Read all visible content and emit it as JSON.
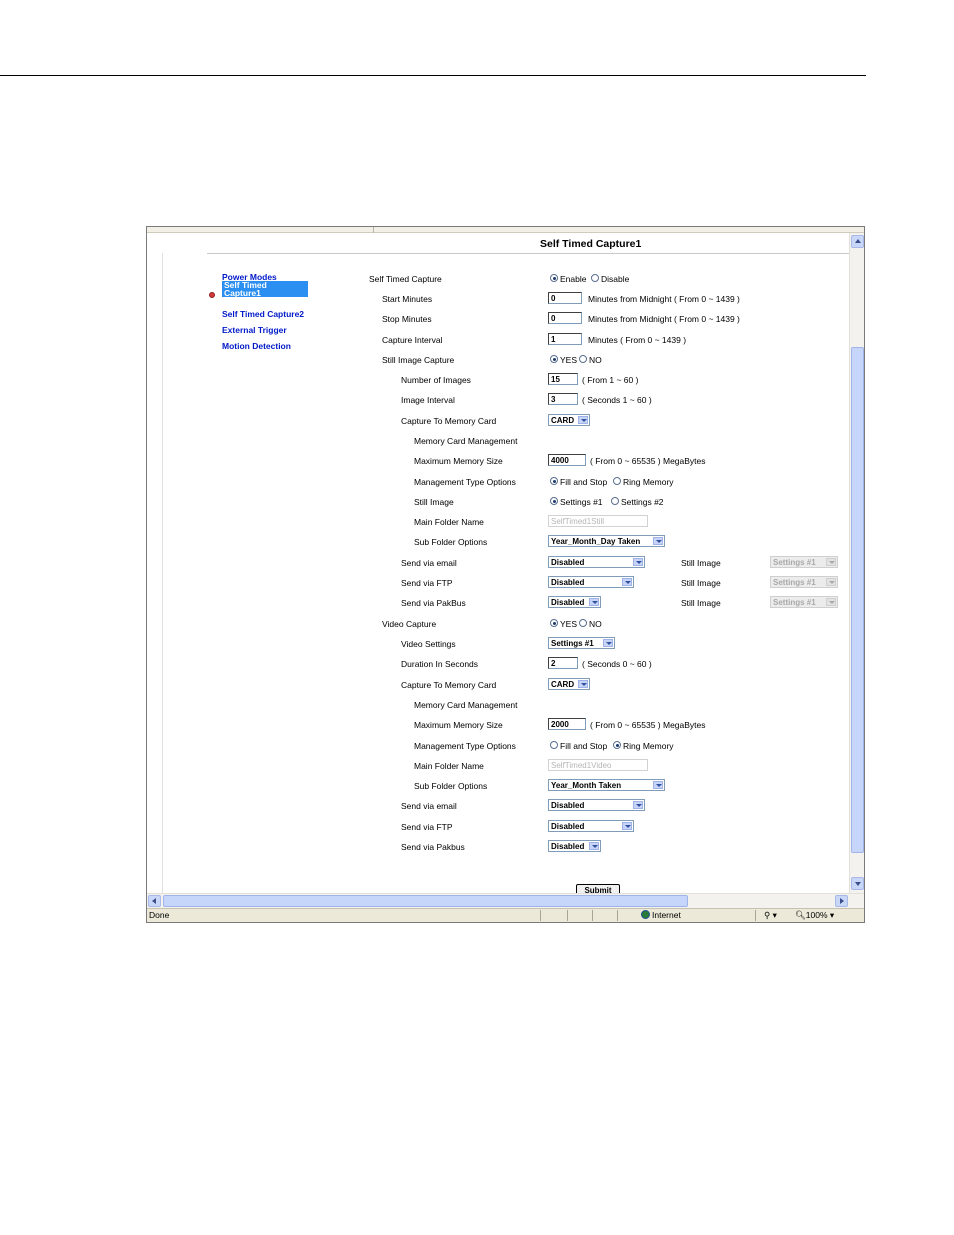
{
  "page_title": "Self Timed Capture1",
  "nav": [
    {
      "label": "Power Modes"
    },
    {
      "label": "Self Timed Capture1",
      "active": true
    },
    {
      "label": "Self Timed Capture2"
    },
    {
      "label": "External Trigger"
    },
    {
      "label": "Motion Detection"
    }
  ],
  "self_timed": {
    "label": "Self Timed Capture",
    "enable": "Enable",
    "disable": "Disable",
    "enabled": true
  },
  "start_minutes": {
    "label": "Start Minutes",
    "value": "0",
    "hint": "Minutes from Midnight ( From 0 ~ 1439 )"
  },
  "stop_minutes": {
    "label": "Stop Minutes",
    "value": "0",
    "hint": "Minutes from Midnight ( From 0 ~ 1439 )"
  },
  "capture_interval": {
    "label": "Capture Interval",
    "value": "1",
    "hint": "Minutes ( From 0 ~ 1439 )"
  },
  "still": {
    "label": "Still Image Capture",
    "yes": "YES",
    "no": "NO",
    "on": true,
    "num_images": {
      "label": "Number of Images",
      "value": "15",
      "hint": "( From 1 ~ 60 )"
    },
    "image_interval": {
      "label": "Image Interval",
      "value": "3",
      "hint": "( Seconds 1 ~ 60 )"
    },
    "capture_to_card": {
      "label": "Capture To Memory Card",
      "value": "CARD"
    },
    "mem_mgmt": "Memory Card Management",
    "max_mem": {
      "label": "Maximum Memory Size",
      "value": "4000",
      "hint": "( From 0 ~ 65535 ) MegaBytes"
    },
    "mgmt_type": {
      "label": "Management Type Options",
      "opt1": "Fill and Stop",
      "opt2": "Ring Memory",
      "selected": 1
    },
    "still_image": {
      "label": "Still Image",
      "opt1": "Settings #1",
      "opt2": "Settings #2",
      "selected": 1
    },
    "main_folder": {
      "label": "Main Folder Name",
      "value": "SelfTimed1Still"
    },
    "sub_folder": {
      "label": "Sub Folder Options",
      "value": "Year_Month_Day Taken"
    },
    "send_email": {
      "label": "Send via email",
      "value": "Disabled",
      "still_label": "Still Image",
      "still_value": "Settings #1"
    },
    "send_ftp": {
      "label": "Send via FTP",
      "value": "Disabled",
      "still_label": "Still Image",
      "still_value": "Settings #1"
    },
    "send_pakbus": {
      "label": "Send via PakBus",
      "value": "Disabled",
      "still_label": "Still Image",
      "still_value": "Settings #1"
    }
  },
  "video": {
    "label": "Video Capture",
    "yes": "YES",
    "no": "NO",
    "on": true,
    "video_settings": {
      "label": "Video Settings",
      "value": "Settings #1"
    },
    "duration": {
      "label": "Duration In Seconds",
      "value": "2",
      "hint": "( Seconds 0 ~ 60 )"
    },
    "capture_to_card": {
      "label": "Capture To Memory Card",
      "value": "CARD"
    },
    "mem_mgmt": "Memory Card Management",
    "max_mem": {
      "label": "Maximum Memory Size",
      "value": "2000",
      "hint": "( From 0 ~ 65535 ) MegaBytes"
    },
    "mgmt_type": {
      "label": "Management Type Options",
      "opt1": "Fill and Stop",
      "opt2": "Ring Memory",
      "selected": 2
    },
    "main_folder": {
      "label": "Main Folder Name",
      "value": "SelfTimed1Video"
    },
    "sub_folder": {
      "label": "Sub Folder Options",
      "value": "Year_Month Taken"
    },
    "send_email": {
      "label": "Send via email",
      "value": "Disabled"
    },
    "send_ftp": {
      "label": "Send via FTP",
      "value": "Disabled"
    },
    "send_pakbus": {
      "label": "Send via Pakbus",
      "value": "Disabled"
    }
  },
  "submit_label": "Submit",
  "status": {
    "left": "Done",
    "zone": "Internet",
    "zoom": "100%"
  }
}
